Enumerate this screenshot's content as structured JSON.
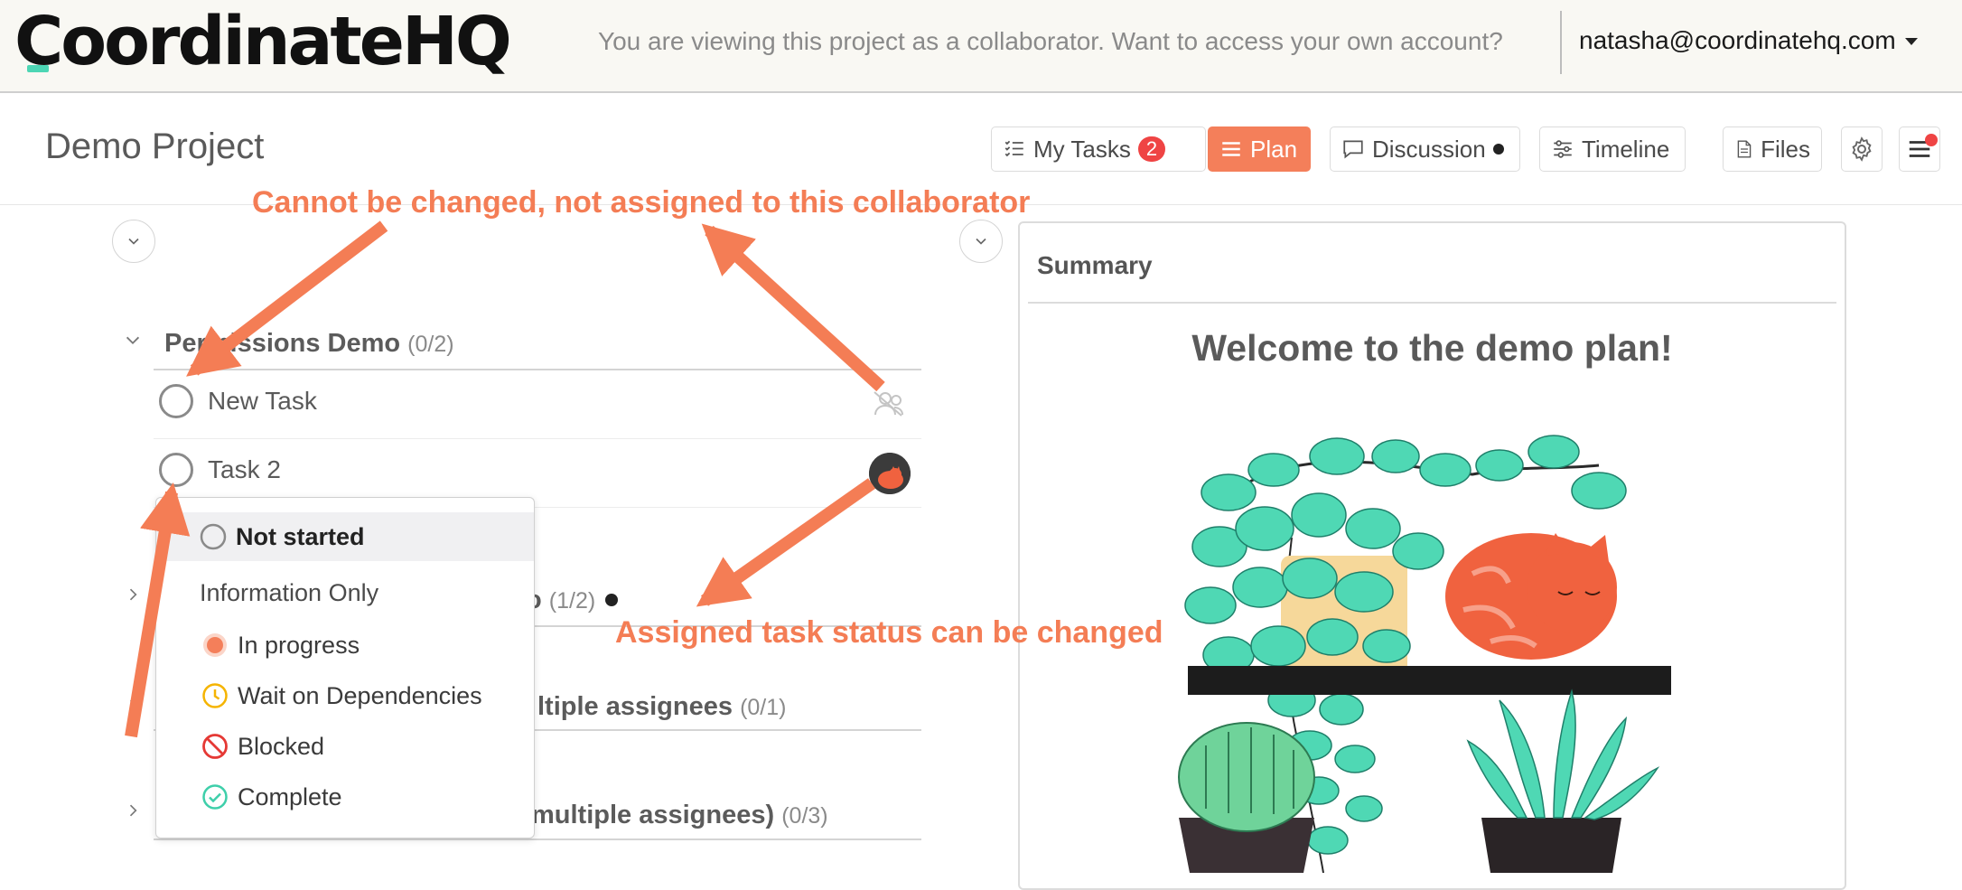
{
  "topbar": {
    "logo": "CoordinateHQ",
    "viewing_text": "You are viewing this project as a collaborator. Want to access your own account?",
    "account_email": "natasha@coordinatehq.com"
  },
  "project": {
    "title": "Demo Project",
    "nav": {
      "my_tasks_label": "My Tasks",
      "my_tasks_count": "2",
      "plan_label": "Plan",
      "discussion_label": "Discussion",
      "timeline_label": "Timeline",
      "files_label": "Files"
    }
  },
  "task_groups": [
    {
      "title": "Permissions Demo",
      "count": "(0/2)"
    },
    {
      "title_tail": "o",
      "count": "(1/2)"
    },
    {
      "title_tail": "ltiple assignees",
      "count": "(0/1)"
    },
    {
      "title_tail": "multiple assignees)",
      "count": "(0/3)"
    }
  ],
  "tasks": [
    {
      "name": "New Task"
    },
    {
      "name": "Task 2"
    }
  ],
  "status_menu": {
    "items": [
      {
        "label": "Not started",
        "icon": "empty-circle-icon",
        "color": "#8a8a8a"
      },
      {
        "label": "Information Only",
        "icon": "",
        "color": ""
      },
      {
        "label": "In progress",
        "icon": "in-progress-icon",
        "color": "#f47f5a"
      },
      {
        "label": "Wait on Dependencies",
        "icon": "clock-icon",
        "color": "#f5b400"
      },
      {
        "label": "Blocked",
        "icon": "blocked-icon",
        "color": "#e53935"
      },
      {
        "label": "Complete",
        "icon": "check-circle-icon",
        "color": "#3ecfaa"
      }
    ]
  },
  "summary": {
    "title": "Summary",
    "welcome": "Welcome to the demo plan!"
  },
  "annotations": {
    "top": "Cannot be changed, not assigned to this collaborator",
    "bottom": "Assigned task status can be changed"
  },
  "colors": {
    "accent": "#f47f5a",
    "annotation": "#f47d55",
    "badge": "#ef4444",
    "logo_mark": "#4dd6b4"
  }
}
